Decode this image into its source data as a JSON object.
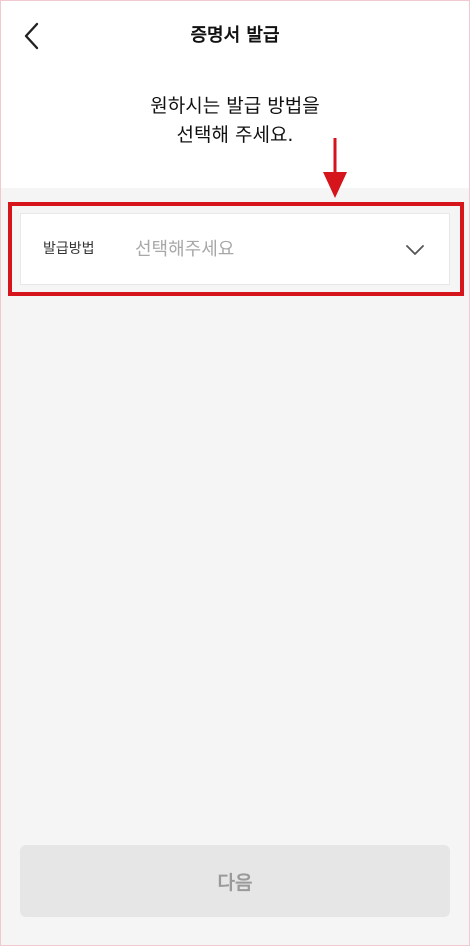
{
  "header": {
    "title": "증명서 발급",
    "back_icon": "chevron-left-icon"
  },
  "instruction": {
    "line1": "원하시는 발급 방법을",
    "line2": "선택해 주세요."
  },
  "method_select": {
    "label": "발급방법",
    "placeholder": "선택해주세요",
    "icon": "chevron-down-icon"
  },
  "footer": {
    "next_label": "다음"
  },
  "colors": {
    "annotation": "#d6141c",
    "background": "#f5f5f5",
    "disabled_button": "#e6e6e6",
    "disabled_text": "#9a9a9a",
    "placeholder": "#a8a8a8"
  }
}
